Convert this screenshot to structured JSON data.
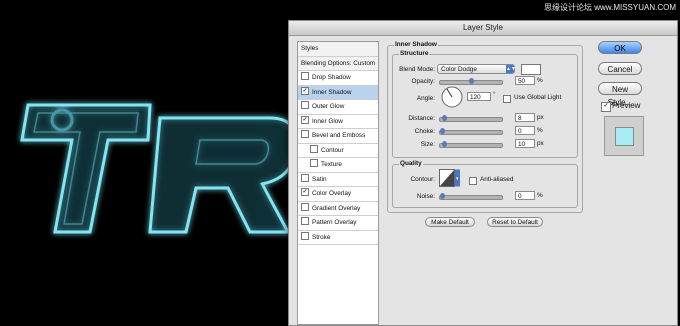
{
  "watermark": "思缘设计论坛 www.MISSYUAN.COM",
  "artwork": {
    "text": "TR",
    "glow_color": "#7fe6f5"
  },
  "dialog": {
    "title": "Layer Style",
    "styles": [
      {
        "label": "Styles",
        "type": "header"
      },
      {
        "label": "Blending Options: Custom",
        "type": "header"
      },
      {
        "label": "Drop Shadow",
        "checked": false
      },
      {
        "label": "Inner Shadow",
        "checked": true,
        "selected": true
      },
      {
        "label": "Outer Glow",
        "checked": false
      },
      {
        "label": "Inner Glow",
        "checked": true
      },
      {
        "label": "Bevel and Emboss",
        "checked": false
      },
      {
        "label": "Contour",
        "checked": false,
        "indent": true
      },
      {
        "label": "Texture",
        "checked": false,
        "indent": true
      },
      {
        "label": "Satin",
        "checked": false
      },
      {
        "label": "Color Overlay",
        "checked": true
      },
      {
        "label": "Gradient Overlay",
        "checked": false
      },
      {
        "label": "Pattern Overlay",
        "checked": false
      },
      {
        "label": "Stroke",
        "checked": false
      }
    ],
    "inner_shadow": {
      "title": "Inner Shadow",
      "structure": {
        "title": "Structure",
        "blend_mode_label": "Blend Mode:",
        "blend_mode_value": "Color Dodge",
        "opacity_label": "Opacity:",
        "opacity_value": "50",
        "opacity_unit": "%",
        "opacity_fraction": 0.5,
        "angle_label": "Angle:",
        "angle_value": "120",
        "angle_unit": "°",
        "global_light_label": "Use Global Light",
        "global_light_checked": false,
        "distance_label": "Distance:",
        "distance_value": "8",
        "distance_unit": "px",
        "distance_fraction": 0.035,
        "choke_label": "Choke:",
        "choke_value": "0",
        "choke_unit": "%",
        "choke_fraction": 0,
        "size_label": "Size:",
        "size_value": "10",
        "size_unit": "px",
        "size_fraction": 0.04
      },
      "quality": {
        "title": "Quality",
        "contour_label": "Contour:",
        "anti_aliased_label": "Anti-aliased",
        "anti_aliased_checked": false,
        "noise_label": "Noise:",
        "noise_value": "0",
        "noise_unit": "%",
        "noise_fraction": 0
      },
      "make_default_label": "Make Default",
      "reset_default_label": "Reset to Default"
    },
    "buttons": {
      "ok": "OK",
      "cancel": "Cancel",
      "new_style": "New Style...",
      "preview_label": "Preview",
      "preview_checked": true
    },
    "colors": {
      "swatch": "#ffffff",
      "preview_fill": "#a8eef4",
      "selection": "#b9d3ee"
    }
  }
}
